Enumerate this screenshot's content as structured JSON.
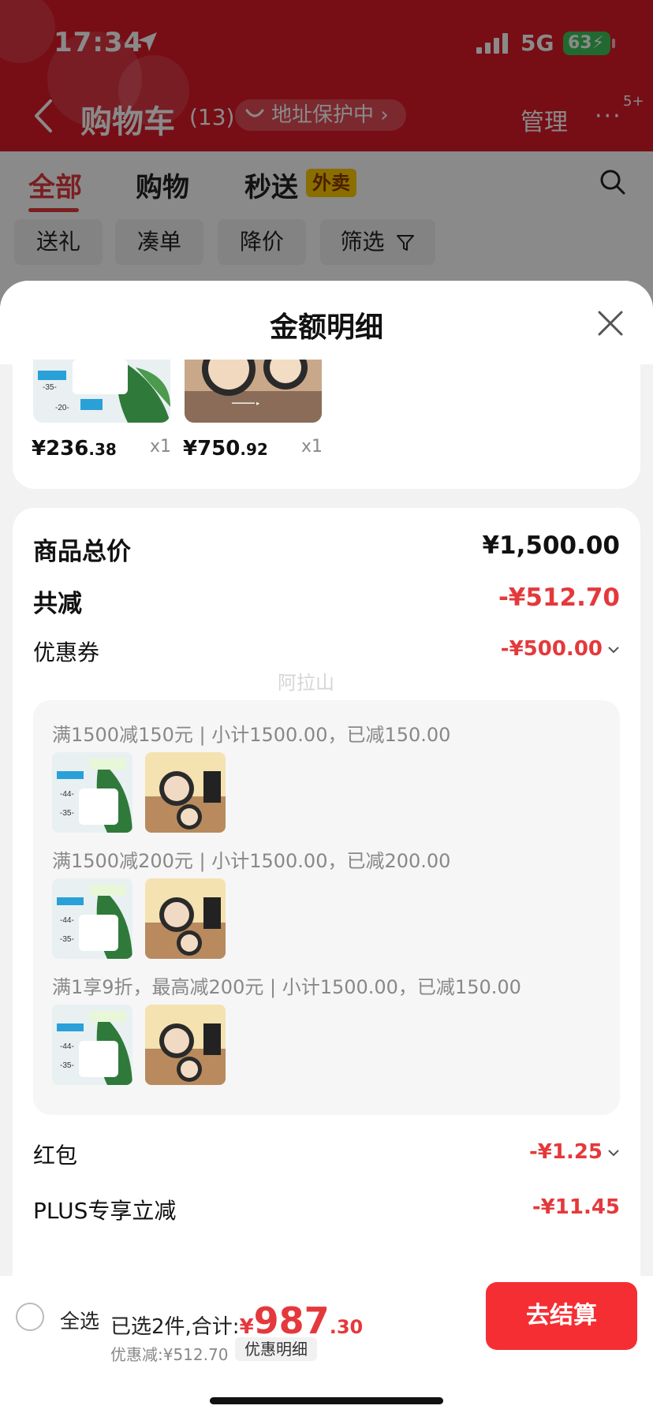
{
  "status_bar": {
    "time": "17:34",
    "network": "5G",
    "battery": "63"
  },
  "cart_header": {
    "title": "购物车",
    "count": "(13)",
    "address_protect": "地址保护中 ›",
    "manage": "管理",
    "more": "···",
    "more_badge": "5+"
  },
  "tabs": [
    {
      "label": "全部"
    },
    {
      "label": "购物"
    },
    {
      "label": "秒送"
    }
  ],
  "waimai_badge": "外卖",
  "filter_chips": [
    {
      "label": "送礼"
    },
    {
      "label": "凑单"
    },
    {
      "label": "降价"
    },
    {
      "label": "筛选"
    }
  ],
  "sheet": {
    "title": "金额明细",
    "goods": [
      {
        "price_symbol": "¥",
        "price_int": "236",
        "price_dec": ".38",
        "qty": "x1",
        "thumb_icon": "cream-jar-product-image"
      },
      {
        "price_symbol": "¥",
        "price_int": "750",
        "price_dec": ".92",
        "qty": "x1",
        "thumb_icon": "pressed-powder-product-image"
      }
    ],
    "summary": {
      "total_label": "商品总价",
      "total_value": "¥1,500.00",
      "reduce_label": "共减",
      "reduce_value": "-¥512.70",
      "coupon_label": "优惠券",
      "coupon_value": "-¥500.00",
      "watermark": "阿拉山",
      "coupons": [
        {
          "text": "满1500减150元 | 小计1500.00，已减150.00"
        },
        {
          "text": "满1500减200元 | 小计1500.00，已减200.00"
        },
        {
          "text": "满1享9折，最高减200元 | 小计1500.00，已减150.00"
        }
      ],
      "redpack_label": "红包",
      "redpack_value": "-¥1.25",
      "plus_label": "PLUS专享立减",
      "plus_value": "-¥11.45"
    }
  },
  "footer": {
    "select_all": "全选",
    "selected_text": "已选2件,合计:",
    "total_symbol": "¥",
    "total_int": "987",
    "total_dec": ".30",
    "discount_text": "优惠减:¥512.70",
    "detail_button": "优惠明细",
    "checkout_button": "去结算"
  },
  "colors": {
    "brand_red": "#e4393c",
    "checkout_red": "#f52e33",
    "header_red": "#dc1a28"
  }
}
